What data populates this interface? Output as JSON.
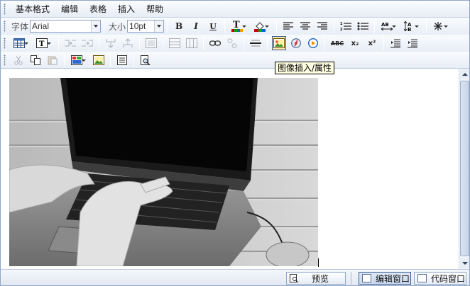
{
  "menu": [
    "基本格式",
    "编辑",
    "表格",
    "插入",
    "帮助"
  ],
  "toolbar1": {
    "font_label": "字体",
    "font_value": "Arial",
    "size_label": "大小",
    "size_value": "10pt",
    "bold": "B",
    "italic": "I",
    "underline": "U",
    "text_color": "T"
  },
  "toolbar2": {
    "spellcheck": "ABC",
    "subscript": "x₂",
    "superscript": "x²"
  },
  "tooltip": "图像插入/属性",
  "statusbar": {
    "preview": "预览",
    "design_mode": "编辑窗口",
    "code_mode": "代码窗口"
  },
  "colors": {
    "accent_border": "#8ea6c7",
    "toolbar_bg": "#e8eef6",
    "active_button": "#ffe6a3",
    "tooltip_bg": "#ffffe1"
  },
  "icons": {
    "row1": [
      "align-left-icon",
      "align-center-icon",
      "align-right-icon",
      "ordered-list-icon",
      "unordered-list-icon",
      "line-height-icon",
      "letter-spacing-icon",
      "more-icon"
    ],
    "row2": [
      "table-icon",
      "textbox-icon",
      "cut-cell-icon",
      "split-cell-icon",
      "merge-icon",
      "row-icon",
      "column-icon",
      "link-icon",
      "unlink-icon",
      "horizontal-rule-icon",
      "image-icon",
      "flash-icon",
      "media-icon"
    ],
    "row3": [
      "cut-icon",
      "copy-icon",
      "paste-icon",
      "insert-object-icon",
      "image-frame-icon",
      "page-icon",
      "find-icon"
    ]
  }
}
